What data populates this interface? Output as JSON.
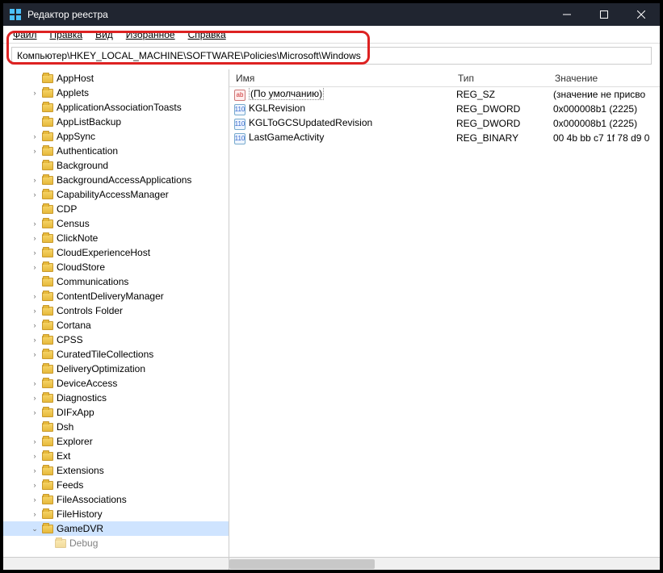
{
  "window": {
    "title": "Редактор реестра"
  },
  "menu": {
    "file": "Файл",
    "edit": "Правка",
    "view": "Вид",
    "favorites": "Избранное",
    "help": "Справка"
  },
  "address": "Компьютер\\HKEY_LOCAL_MACHINE\\SOFTWARE\\Policies\\Microsoft\\Windows",
  "tree": [
    {
      "name": "AppHost",
      "expandable": false
    },
    {
      "name": "Applets",
      "expandable": true
    },
    {
      "name": "ApplicationAssociationToasts",
      "expandable": false
    },
    {
      "name": "AppListBackup",
      "expandable": false
    },
    {
      "name": "AppSync",
      "expandable": true
    },
    {
      "name": "Authentication",
      "expandable": true
    },
    {
      "name": "Background",
      "expandable": false
    },
    {
      "name": "BackgroundAccessApplications",
      "expandable": true
    },
    {
      "name": "CapabilityAccessManager",
      "expandable": true
    },
    {
      "name": "CDP",
      "expandable": false
    },
    {
      "name": "Census",
      "expandable": true
    },
    {
      "name": "ClickNote",
      "expandable": true
    },
    {
      "name": "CloudExperienceHost",
      "expandable": true
    },
    {
      "name": "CloudStore",
      "expandable": true
    },
    {
      "name": "Communications",
      "expandable": false
    },
    {
      "name": "ContentDeliveryManager",
      "expandable": true
    },
    {
      "name": "Controls Folder",
      "expandable": true
    },
    {
      "name": "Cortana",
      "expandable": true
    },
    {
      "name": "CPSS",
      "expandable": true
    },
    {
      "name": "CuratedTileCollections",
      "expandable": true
    },
    {
      "name": "DeliveryOptimization",
      "expandable": false
    },
    {
      "name": "DeviceAccess",
      "expandable": true
    },
    {
      "name": "Diagnostics",
      "expandable": true
    },
    {
      "name": "DIFxApp",
      "expandable": true
    },
    {
      "name": "Dsh",
      "expandable": false
    },
    {
      "name": "Explorer",
      "expandable": true
    },
    {
      "name": "Ext",
      "expandable": true
    },
    {
      "name": "Extensions",
      "expandable": true
    },
    {
      "name": "Feeds",
      "expandable": true
    },
    {
      "name": "FileAssociations",
      "expandable": true
    },
    {
      "name": "FileHistory",
      "expandable": true
    },
    {
      "name": "GameDVR",
      "expandable": true,
      "selected": true,
      "expanded": true
    }
  ],
  "tree_child": "Debug",
  "columns": {
    "name": "Имя",
    "type": "Тип",
    "value": "Значение"
  },
  "values": [
    {
      "icon": "str",
      "name": "(По умолчанию)",
      "type": "REG_SZ",
      "value": "(значение не присво",
      "default": true
    },
    {
      "icon": "bin",
      "name": "KGLRevision",
      "type": "REG_DWORD",
      "value": "0x000008b1 (2225)"
    },
    {
      "icon": "bin",
      "name": "KGLToGCSUpdatedRevision",
      "type": "REG_DWORD",
      "value": "0x000008b1 (2225)"
    },
    {
      "icon": "bin",
      "name": "LastGameActivity",
      "type": "REG_BINARY",
      "value": "00 4b bb c7 1f 78 d9 0"
    }
  ]
}
